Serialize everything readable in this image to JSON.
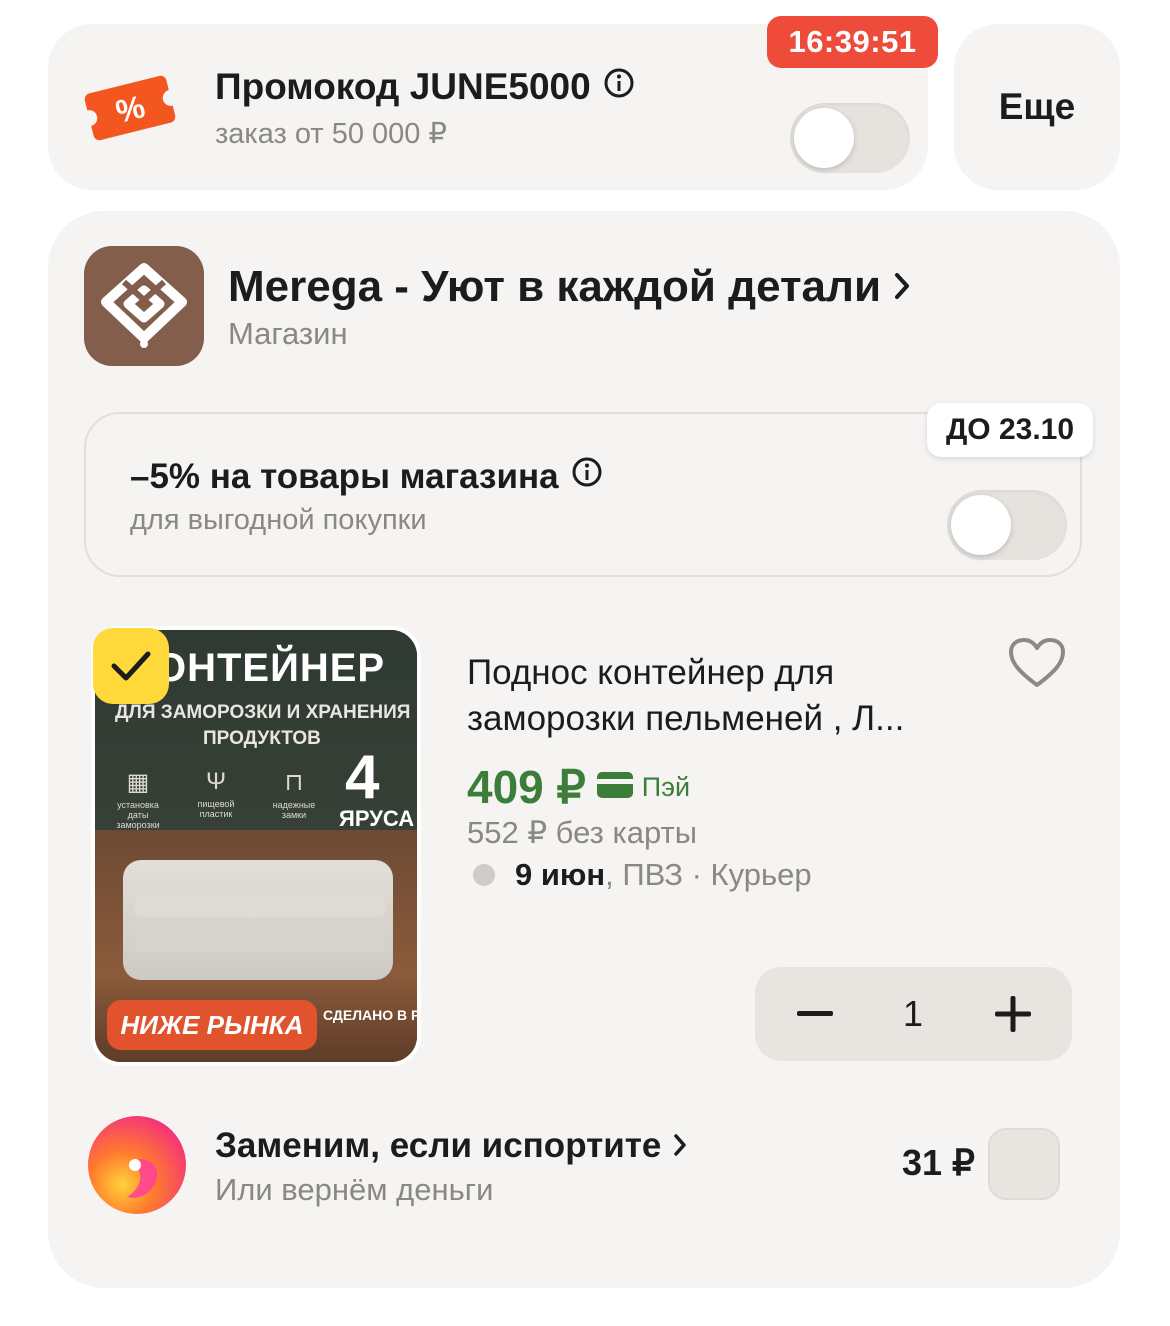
{
  "promo": {
    "timer": "16:39:51",
    "title": "Промокод JUNE5000",
    "subtitle": "заказ от 50 000 ₽",
    "toggle_on": false
  },
  "more": {
    "label": "Еще"
  },
  "shop": {
    "name": "Merega - Уют в каждой детали",
    "type": "Магазин",
    "logo_color": "#835e4c"
  },
  "discount": {
    "deadline": "ДО 23.10",
    "title": "–5% на товары магазина",
    "subtitle": "для выгодной покупки",
    "toggle_on": false
  },
  "product": {
    "selected": true,
    "title": "Поднос контейнер для заморозки пельменей , Л...",
    "price": "409 ₽",
    "pay_label": "Пэй",
    "old_price": "552 ₽ без карты",
    "delivery_date": "9 июн",
    "delivery_rest": ", ПВЗ · Курьер",
    "quantity": "1",
    "image": {
      "headline": "ОНТЕЙНЕР",
      "line1": "ДЛЯ ЗАМОРОЗКИ И ХРАНЕНИЯ",
      "line2": "ПРОДУКТОВ",
      "tiers_number": "4",
      "tiers_label": "ЯРУСА",
      "icon1": "установка даты заморозки",
      "icon2": "пищевой пластик",
      "icon3": "надежные замки",
      "banner": "НИЖЕ РЫНКА",
      "made_in": "СДЕЛАНО В РОССИИ"
    }
  },
  "insurance": {
    "title": "Заменим, если испортите",
    "subtitle": "Или вернём деньги",
    "price": "31 ₽",
    "checked": false
  },
  "colors": {
    "accent_green": "#3d7d3a",
    "timer_red": "#ee4b3b",
    "check_yellow": "#ffd83a",
    "promo_orange": "#f4561f"
  }
}
